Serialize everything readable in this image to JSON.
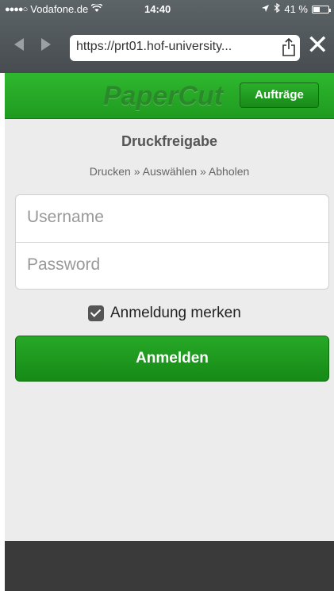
{
  "status_bar": {
    "signal": "●●●●○",
    "carrier": "Vodafone.de",
    "wifi": "wifi-icon",
    "time": "14:40",
    "location": "location-arrow-icon",
    "bluetooth": "bluetooth-icon",
    "battery": "41 %"
  },
  "browser": {
    "url": "https://prt01.hof-university...",
    "share": "share-icon",
    "close": "✕"
  },
  "header": {
    "logo": "PaperCut",
    "jobs_button": "Aufträge",
    "accent_color": "#1f9b1f"
  },
  "main": {
    "title": "Druckfreigabe",
    "breadcrumb": "Drucken » Auswählen » Abholen",
    "username_placeholder": "Username",
    "password_placeholder": "Password",
    "remember_label": "Anmeldung merken",
    "remember_checked": true,
    "login_button": "Anmelden"
  }
}
